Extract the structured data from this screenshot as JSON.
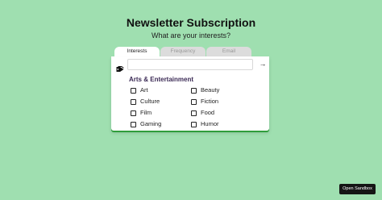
{
  "page": {
    "title": "Newsletter Subscription",
    "subtitle": "What are your interests?"
  },
  "tabs": [
    {
      "label": "Interests",
      "active": true
    },
    {
      "label": "Frequency",
      "active": false
    },
    {
      "label": "Email",
      "active": false
    }
  ],
  "search": {
    "value": "",
    "placeholder": "",
    "tag_icon": "tag-icon",
    "submit_icon": "arrow-right-icon"
  },
  "category": {
    "title": "Arts & Entertainment",
    "options": [
      {
        "label": "Art",
        "checked": false
      },
      {
        "label": "Beauty",
        "checked": false
      },
      {
        "label": "Culture",
        "checked": false
      },
      {
        "label": "Fiction",
        "checked": false
      },
      {
        "label": "Film",
        "checked": false
      },
      {
        "label": "Food",
        "checked": false
      },
      {
        "label": "Gaming",
        "checked": false
      },
      {
        "label": "Humor",
        "checked": false
      }
    ]
  },
  "sandbox": {
    "label": "Open Sandbox"
  },
  "colors": {
    "background": "#9fdfb0",
    "accent": "#2f9e3c",
    "category_text": "#3b2a55"
  }
}
